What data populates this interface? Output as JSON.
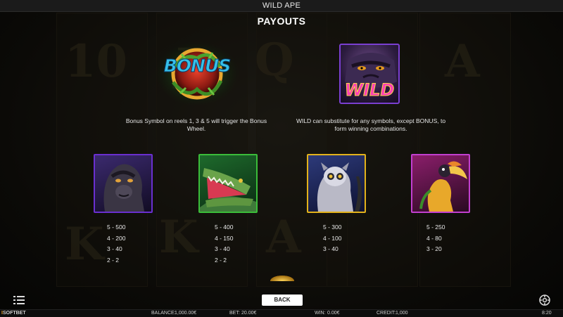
{
  "window": {
    "title": "WILD APE"
  },
  "page": {
    "title": "PAYOUTS"
  },
  "background_letters": [
    "10",
    "J",
    "Q",
    "K",
    "A",
    "K",
    "A"
  ],
  "bonus": {
    "logo_text": "BONUS",
    "description": "Bonus Symbol on reels 1, 3 & 5 will trigger the Bonus Wheel."
  },
  "wild": {
    "logo_text": "WILD",
    "description": "WILD can substitute for any symbols, except BONUS, to form winning combinations."
  },
  "symbols": [
    {
      "name": "gorilla",
      "frame_color": "#6a2fd0",
      "payouts": [
        "5 - 500",
        "4 - 200",
        "3 - 40",
        "2 - 2"
      ]
    },
    {
      "name": "crocodile",
      "frame_color": "#3bbd3a",
      "payouts": [
        "5 - 400",
        "4 - 150",
        "3 - 40",
        "2 - 2"
      ]
    },
    {
      "name": "lemur",
      "frame_color": "#e3b21b",
      "payouts": [
        "5 - 300",
        "4 - 100",
        "3 - 40"
      ]
    },
    {
      "name": "hornbill",
      "frame_color": "#c23fcf",
      "payouts": [
        "5 - 250",
        "4 - 80",
        "3 - 20"
      ]
    }
  ],
  "controls": {
    "back_label": "BACK",
    "menu_icon": "hamburger-menu-icon",
    "settings_icon": "settings-icon"
  },
  "status": {
    "brand_prefix": "I",
    "brand_rest": "SOFTBET",
    "balance_label": "BALANCE:",
    "balance_value": "1,000.00€",
    "bet_label": "BET:",
    "bet_value": "20.00€",
    "win_label": "WIN:",
    "win_value": "0.00€",
    "credit_label": "CREDIT:",
    "credit_value": "1,000",
    "clock": "8:20"
  }
}
